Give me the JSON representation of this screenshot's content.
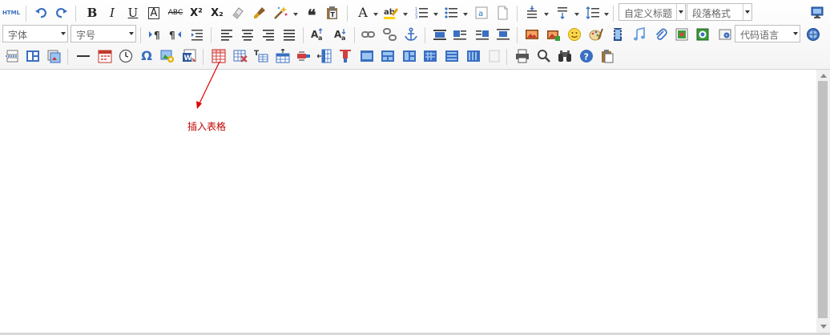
{
  "toolbar": {
    "html_label": "HTML",
    "bold": "B",
    "italic": "I",
    "underline": "U",
    "border_text": "A",
    "strike": "ABC",
    "superscript": "X²",
    "subscript": "X₂",
    "font_color": "A",
    "font_family_placeholder": "字体",
    "font_size_placeholder": "字号",
    "custom_heading": "自定义标题",
    "paragraph_format": "段落格式",
    "code_language": "代码语言",
    "special_char": "Ω",
    "quote": "❝"
  },
  "annotation": {
    "text": "插入表格",
    "color": "#cc0000"
  },
  "colors": {
    "icon_blue": "#3a6fc2",
    "table_red": "#d04040",
    "toolbar_bg": "#f4f4f4"
  }
}
